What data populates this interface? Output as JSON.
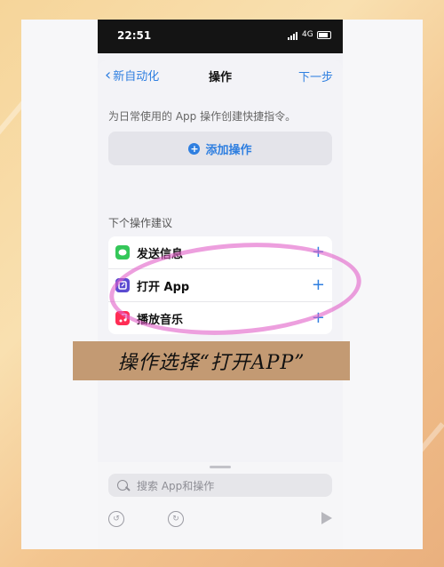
{
  "status_bar": {
    "time": "22:51",
    "network": "4G"
  },
  "nav": {
    "back_label": "新自动化",
    "title": "操作",
    "next_label": "下一步"
  },
  "hint_text": "为日常使用的 App 操作创建快捷指令。",
  "add_action_label": "添加操作",
  "suggestions": {
    "header": "下个操作建议",
    "items": [
      {
        "label": "发送信息",
        "icon": "messages-icon",
        "color": "#34c759"
      },
      {
        "label": "打开 App",
        "icon": "open-app-icon",
        "color": "#5b4bd1"
      },
      {
        "label": "播放音乐",
        "icon": "music-icon",
        "color": "#ff2d55"
      }
    ]
  },
  "search": {
    "placeholder": "搜索 App和操作"
  },
  "overlay": {
    "caption": "操作选择“打开APP”",
    "highlight_color": "#e15fc8",
    "caption_bg": "#c39a73"
  },
  "colors": {
    "accent": "#2f7fe0"
  }
}
